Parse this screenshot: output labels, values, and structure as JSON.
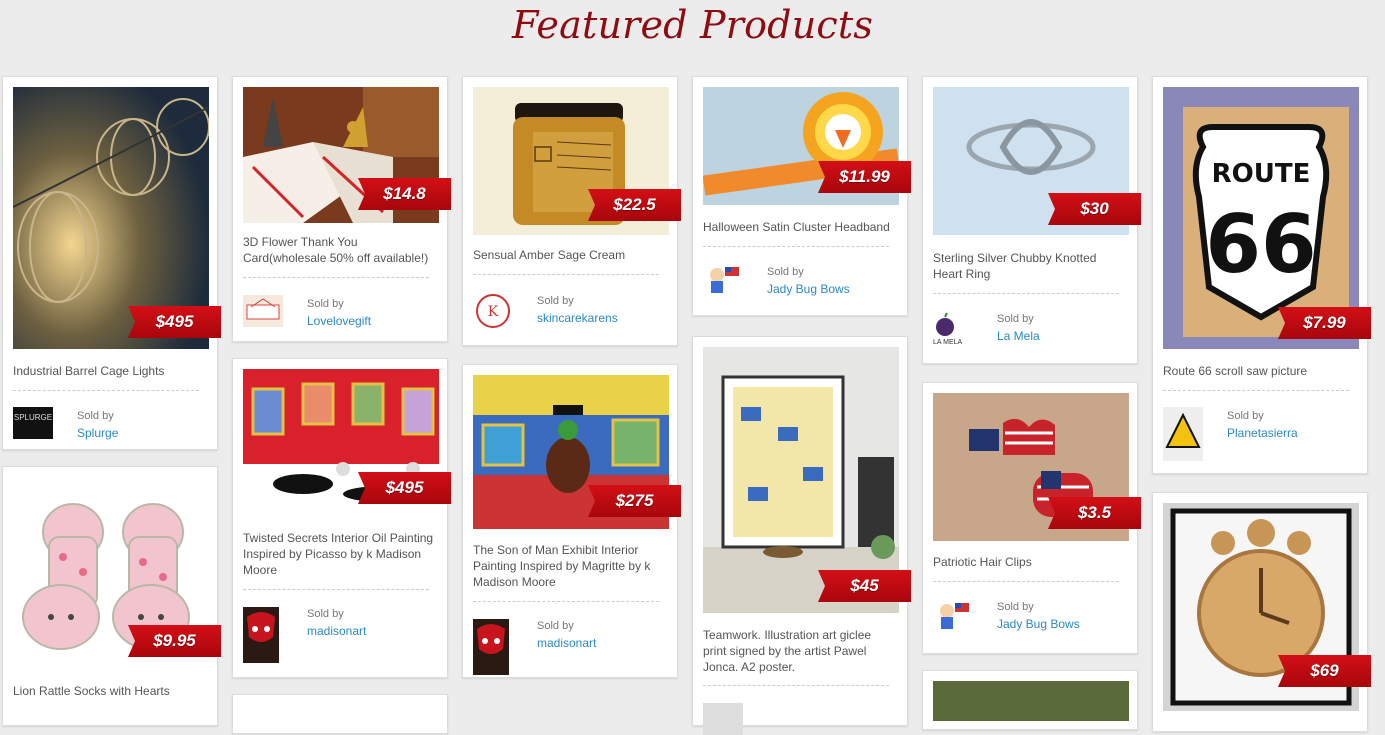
{
  "page": {
    "title": "Featured Products",
    "sold_by_label": "Sold by"
  },
  "products": [
    {
      "title": "Industrial Barrel Cage Lights",
      "price": "$495",
      "seller": "Splurge",
      "seller_logo": "SPLURGE"
    },
    {
      "title": "Lion Rattle Socks with Hearts",
      "price": "$9.95"
    },
    {
      "title": "3D Flower Thank You Card(wholesale 50% off available!)",
      "price": "$14.8",
      "seller": "Lovelovegift"
    },
    {
      "title": "Twisted Secrets Interior Oil Painting Inspired by Picasso by k Madison Moore",
      "price": "$495",
      "seller": "madisonart"
    },
    {
      "title": "Sensual Amber Sage Cream",
      "price": "$22.5",
      "seller": "skincarekarens"
    },
    {
      "title": "The Son of Man Exhibit Interior Painting Inspired by Magritte by k Madison Moore",
      "price": "$275",
      "seller": "madisonart"
    },
    {
      "title": "Halloween Satin Cluster Headband",
      "price": "$11.99",
      "seller": "Jady Bug Bows"
    },
    {
      "title": "Teamwork. Illustration art giclee print signed by the artist Pawel Jonca. A2 poster.",
      "price": "$45"
    },
    {
      "title": "Sterling Silver Chubby Knotted Heart Ring",
      "price": "$30",
      "seller": "La Mela",
      "seller_logo": "LA MELA"
    },
    {
      "title": "Patriotic Hair Clips",
      "price": "$3.5",
      "seller": "Jady Bug Bows"
    },
    {
      "title": "Route 66 scroll saw picture",
      "price": "$7.99",
      "seller": "Planetasierra"
    },
    {
      "title": "",
      "price": "$69"
    }
  ],
  "images": {
    "route_sign_top": "ROUTE",
    "route_sign_num": "66"
  },
  "colors": {
    "accent": "#8f0b12",
    "tag": "#c40d14",
    "link": "#2a8ac7"
  }
}
